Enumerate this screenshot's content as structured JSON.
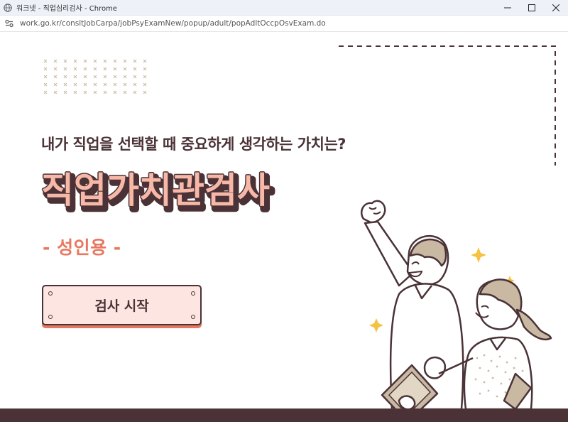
{
  "window": {
    "title": "워크넷 - 직업심리검사 - Chrome",
    "controls": [
      "minimize-icon",
      "maximize-icon",
      "close-icon"
    ]
  },
  "address_bar": {
    "url": "work.go.kr/consltJobCarpa/jobPsyExamNew/popup/adult/popAdltOccpOsvExam.do",
    "icon": "site-settings-icon"
  },
  "hero": {
    "subtitle": "내가 직업을 선택할 때 중요하게 생각하는 가치는?",
    "title": "직업가치관검사",
    "tagline": "- 성인용 -"
  },
  "start_button": {
    "label": "검사 시작"
  },
  "colors": {
    "dark_brown": "#4a3236",
    "accent_coral": "#e8775f",
    "button_fill": "#fde6e1",
    "sparkle_gold": "#f5c242",
    "beige": "#c9b9a3"
  }
}
